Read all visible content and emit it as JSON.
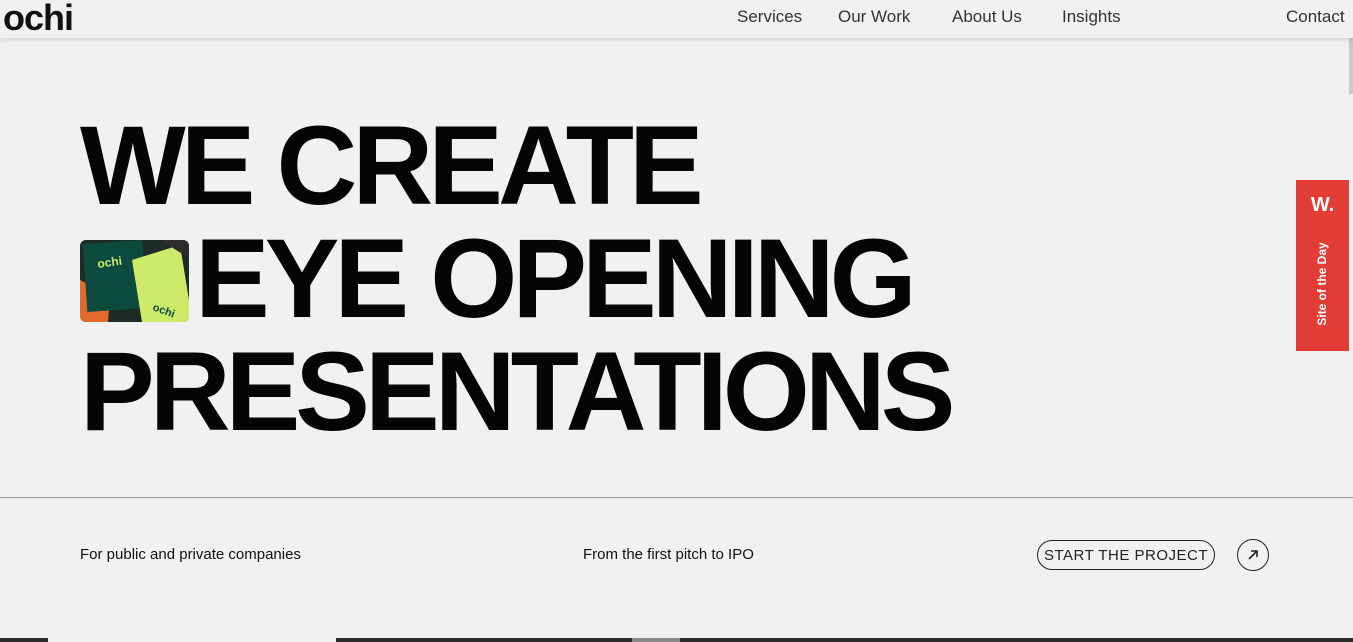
{
  "nav": {
    "logo": "ochi",
    "links": [
      "Services",
      "Our Work",
      "About Us",
      "Insights"
    ],
    "contact": "Contact"
  },
  "hero": {
    "lines": [
      "WE CREATE",
      "EYE OPENING",
      "PRESENTATIONS"
    ],
    "thumbnail_logo_text": "ochi"
  },
  "info": {
    "left": "For public and private companies",
    "middle": "From the first pitch to IPO",
    "cta_label": "START THE PROJECT"
  },
  "award": {
    "logo": "W.",
    "label": "Site of the Day",
    "color": "#e23e37"
  },
  "colors": {
    "background": "#f1f1f1",
    "text": "#111111",
    "accent_green": "#cdea68",
    "thumbnail_dark": "#004d43",
    "thumbnail_orange": "#e36a2c"
  },
  "icons": {
    "cta_arrow": "arrow-up-right-icon"
  }
}
